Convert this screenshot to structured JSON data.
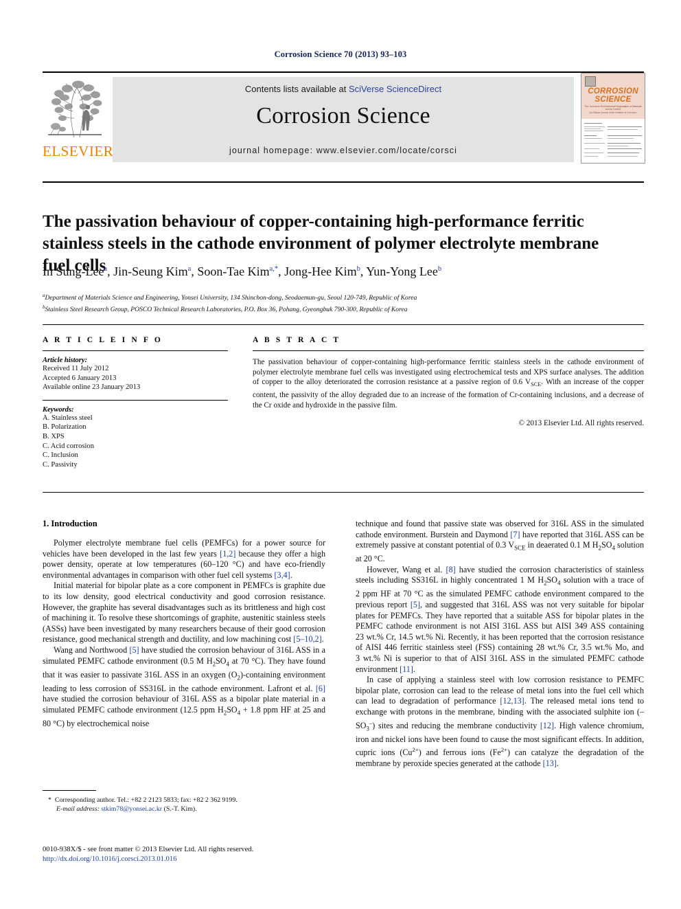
{
  "running_head": "Corrosion Science 70 (2013) 93–103",
  "masthead": {
    "contents_prefix": "Contents lists available at ",
    "contents_link": "SciVerse ScienceDirect",
    "journal_name": "Corrosion Science",
    "homepage": "journal homepage: www.elsevier.com/locate/corsci",
    "publisher_wordmark": "ELSEVIER",
    "cover": {
      "title_line1": "CORROSION",
      "title_line2": "SCIENCE",
      "subtitle1": "The Journal on Environmental Degradation of Materials and its Control",
      "subtitle2": "An Official Journal of the Institute of Corrosion"
    }
  },
  "article": {
    "title": "The passivation behaviour of copper-containing high-performance ferritic stainless steels in the cathode environment of polymer electrolyte membrane fuel cells",
    "authors": [
      {
        "name": "In Sung-Lee",
        "marks": "a"
      },
      {
        "name": "Jin-Seung Kim",
        "marks": "a"
      },
      {
        "name": "Soon-Tae Kim",
        "marks": "a,*"
      },
      {
        "name": "Jong-Hee Kim",
        "marks": "b"
      },
      {
        "name": "Yun-Yong Lee",
        "marks": "b"
      }
    ],
    "affiliations": [
      {
        "mark": "a",
        "text": "Department of Materials Science and Engineering, Yonsei University, 134 Shinchon-dong, Seodaemun-gu, Seoul 120-749, Republic of Korea"
      },
      {
        "mark": "b",
        "text": "Stainless Steel Research Group, POSCO Technical Research Laboratories, P.O. Box 36, Pohang, Gyeongbuk 790-300, Republic of Korea"
      }
    ]
  },
  "info": {
    "heading": "A R T I C L E    I N F O",
    "history_label": "Article history:",
    "history": [
      "Received 11 July 2012",
      "Accepted 6 January 2013",
      "Available online 23 January 2013"
    ],
    "keywords_label": "Keywords:",
    "keywords": [
      "A. Stainless steel",
      "B. Polarization",
      "B. XPS",
      "C. Acid corrosion",
      "C. Inclusion",
      "C. Passivity"
    ]
  },
  "abstract": {
    "heading": "A B S T R A C T",
    "body_part1": "The passivation behaviour of copper-containing high-performance ferritic stainless steels in the cathode environment of polymer electrolyte membrane fuel cells was investigated using electrochemical tests and XPS surface analyses. The addition of copper to the alloy deteriorated the corrosion resistance at a passive region of 0.6 V",
    "body_sub1": "SCE",
    "body_part2": ". With an increase of the copper content, the passivity of the alloy degraded due to an increase of the formation of Cr-containing inclusions, and a decrease of the Cr oxide and hydroxide in the passive film.",
    "copyright": "© 2013 Elsevier Ltd. All rights reserved."
  },
  "body": {
    "section_title": "1. Introduction",
    "left_paragraphs": [
      "Polymer electrolyte membrane fuel cells (PEMFCs) for a power source for vehicles have been developed in the last few years [1,2] because they offer a high power density, operate at low temperatures (60–120 °C) and have eco-friendly environmental advantages in comparison with other fuel cell systems [3,4].",
      "Initial material for bipolar plate as a core component in PEMFCs is graphite due to its low density, good electrical conductivity and good corrosion resistance. However, the graphite has several disadvantages such as its brittleness and high cost of machining it. To resolve these shortcomings of graphite, austenitic stainless steels (ASSs) have been investigated by many researchers because of their good corrosion resistance, good mechanical strength and ductility, and low machining cost [5–10,2].",
      "Wang and Northwood [5] have studied the corrosion behaviour of 316L ASS in a simulated PEMFC cathode environment (0.5 M H2SO4 at 70 °C). They have found that it was easier to passivate 316L ASS in an oxygen (O2)-containing environment leading to less corrosion of SS316L in the cathode environment. Lafront et al. [6] have studied the corrosion behaviour of 316L ASS as a bipolar plate material in a simulated PEMFC cathode environment (12.5 ppm H2SO4 + 1.8 ppm HF at 25 and 80 °C) by electrochemical noise"
    ],
    "right_paragraphs": [
      "technique and found that passive state was observed for 316L ASS in the simulated cathode environment. Burstein and Daymond [7] have reported that 316L ASS can be extremely passive at constant potential of 0.3 VSCE in deaerated 0.1 M H2SO4 solution at 20 °C.",
      "However, Wang et al. [8] have studied the corrosion characteristics of stainless steels including SS316L in highly concentrated 1 M H2SO4 solution with a trace of 2 ppm HF at 70 °C as the simulated PEMFC cathode environment compared to the previous report [5], and suggested that 316L ASS was not very suitable for bipolar plates for PEMFCs. They have reported that a suitable ASS for bipolar plates in the PEMFC cathode environment is not AISI 316L ASS but AISI 349 ASS containing 23 wt.% Cr, 14.5 wt.% Ni. Recently, it has been reported that the corrosion resistance of AISI 446 ferritic stainless steel (FSS) containing 28 wt.% Cr, 3.5 wt.% Mo, and 3 wt.% Ni is superior to that of AISI 316L ASS in the simulated PEMFC cathode environment [11].",
      "In case of applying a stainless steel with low corrosion resistance to PEMFC bipolar plate, corrosion can lead to the release of metal ions into the fuel cell which can lead to degradation of performance [12,13]. The released metal ions tend to exchange with protons in the membrane, binding with the associated sulphite ion (–SO3–) sites and reducing the membrane conductivity [12]. High valence chromium, iron and nickel ions have been found to cause the most significant effects. In addition, cupric ions (Cu2+) and ferrous ions (Fe2+) can catalyze the degradation of the membrane by peroxide species generated at the cathode [13]."
    ]
  },
  "footnote": {
    "star": "*",
    "corresponding": "Corresponding author. Tel.: +82 2 2123 5833; fax: +82 2 362 9199.",
    "email_label": "E-mail address:",
    "email": "stkim78@yonsei.ac.kr",
    "email_suffix": "(S.-T. Kim)."
  },
  "footer": {
    "line1": "0010-938X/$ - see front matter © 2013 Elsevier Ltd. All rights reserved.",
    "doi": "http://dx.doi.org/10.1016/j.corsci.2013.01.016"
  },
  "colors": {
    "link": "#1c3faa",
    "runhead": "#16215b",
    "elsevier_orange": "#F08000",
    "band_gray": "#e3e3e3",
    "cover_peach": "#f2d8cc"
  }
}
